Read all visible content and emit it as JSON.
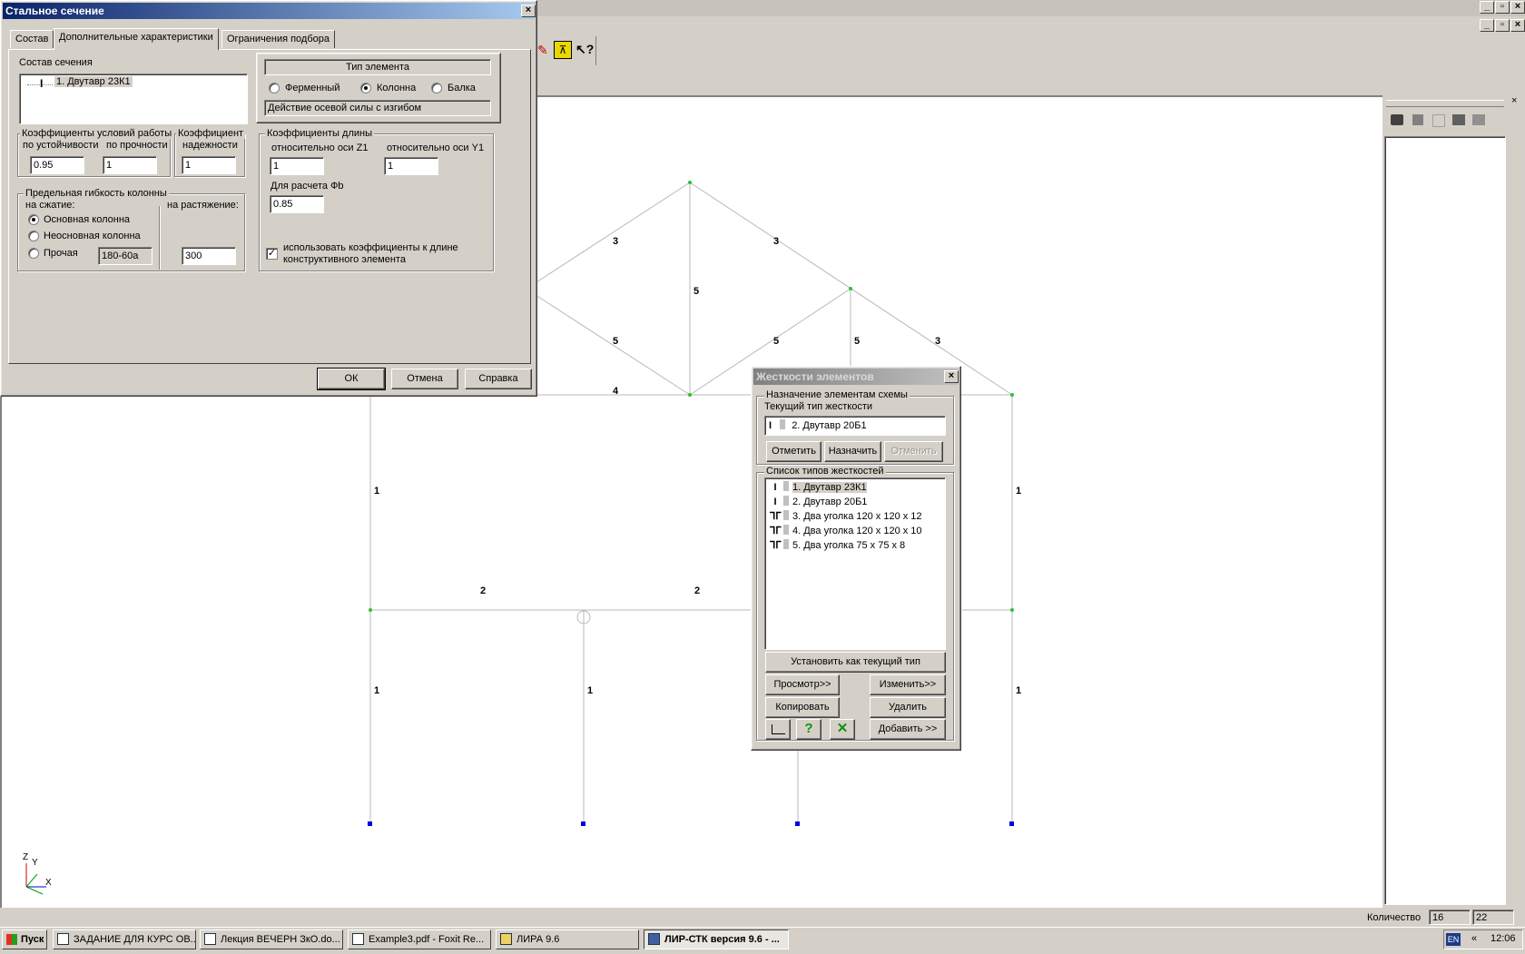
{
  "app": {
    "mdi_buttons": [
      "_",
      "▫",
      "×"
    ]
  },
  "scheme": {
    "labels": [
      "3",
      "3",
      "5",
      "5",
      "5",
      "5",
      "3",
      "4",
      "4",
      "1",
      "1",
      "2",
      "2",
      "1",
      "1",
      "1"
    ],
    "axis": {
      "z": "Z",
      "y": "Y",
      "x": "X"
    }
  },
  "steel_dialog": {
    "title": "Стальное сечение",
    "close": "×",
    "tabs": [
      "Состав",
      "Дополнительные характеристики",
      "Ограничения подбора"
    ],
    "active_tab": 1,
    "section_group_label": "Состав сечения",
    "section_tree_item": "1. Двутавр 23К1",
    "element_type": {
      "title": "Тип элемента",
      "options": [
        "Ферменный",
        "Колонна",
        "Балка"
      ],
      "selected": "Колонна",
      "description": "Действие осевой силы с изгибом"
    },
    "coeffs": {
      "group_label": "Коэффициенты условий работы",
      "stability_label": "по устойчивости",
      "strength_label": "по прочности",
      "stability_value": "0.95",
      "strength_value": "1",
      "reliability_label1": "Коэффициент",
      "reliability_label2": "надежности",
      "reliability_value": "1"
    },
    "length_coeffs": {
      "group_label": "Коэффициенты длины",
      "z1_label": "относительно оси  Z1",
      "y1_label": "относительно оси Y1",
      "z1_value": "1",
      "y1_value": "1",
      "phib_label": "Для расчета Фb",
      "phib_value": "0.85",
      "use_checkbox_checked": true,
      "use_checkbox_label1": "использовать коэффициенты к длине",
      "use_checkbox_label2": "конструктивного элемента"
    },
    "slenderness": {
      "group_label": "Предельная гибкость колонны",
      "compression_label": "на сжатие:",
      "tension_label": "на растяжение:",
      "options": [
        "Основная колонна",
        "Неосновная колонна",
        "Прочая"
      ],
      "selected": "Основная колонна",
      "other_value": "180-60a",
      "tension_value": "300"
    },
    "buttons": {
      "ok": "ОК",
      "cancel": "Отмена",
      "help": "Справка"
    }
  },
  "stiff_dialog": {
    "title": "Жесткости элементов",
    "close": "×",
    "assign_group_label": "Назначение элементам схемы",
    "current_type_label": "Текущий тип жесткости",
    "current_type_value": "2. Двутавр 20Б1",
    "buttons": {
      "mark": "Отметить",
      "assign": "Назначить",
      "undo": "Отменить",
      "set_current": "Установить как текущий тип",
      "view": "Просмотр>>",
      "edit": "Изменить>>",
      "copy": "Копировать",
      "delete": "Удалить",
      "add": "Добавить >>"
    },
    "list_group_label": "Список типов жесткостей",
    "types": [
      {
        "icon": "I",
        "label": "1. Двутавр 23К1"
      },
      {
        "icon": "I",
        "label": "2. Двутавр 20Б1"
      },
      {
        "icon": "ᒣᒥ",
        "label": "3. Два уголка 120 x 120 x 12"
      },
      {
        "icon": "ᒣᒥ",
        "label": "4. Два уголка 120 x 120 x 10"
      },
      {
        "icon": "ᒣᒥ",
        "label": "5. Два уголка 75 x 75 x 8"
      }
    ],
    "selected_index": 0
  },
  "right_panel": {
    "close": "×"
  },
  "status": {
    "count_label": "Количество",
    "count_value": "16",
    "count_value2": "22"
  },
  "taskbar": {
    "start": "Пуск",
    "tasks": [
      "ЗАДАНИЕ ДЛЯ КУРС ОВ...",
      "Лекция ВЕЧЕРН ЗкО.do...",
      "Example3.pdf - Foxit Re...",
      "ЛИРА 9.6",
      "ЛИР-СТК версия 9.6 - ..."
    ],
    "active_task": 4,
    "lang": "EN",
    "chevron": "«",
    "clock": "12:06"
  }
}
